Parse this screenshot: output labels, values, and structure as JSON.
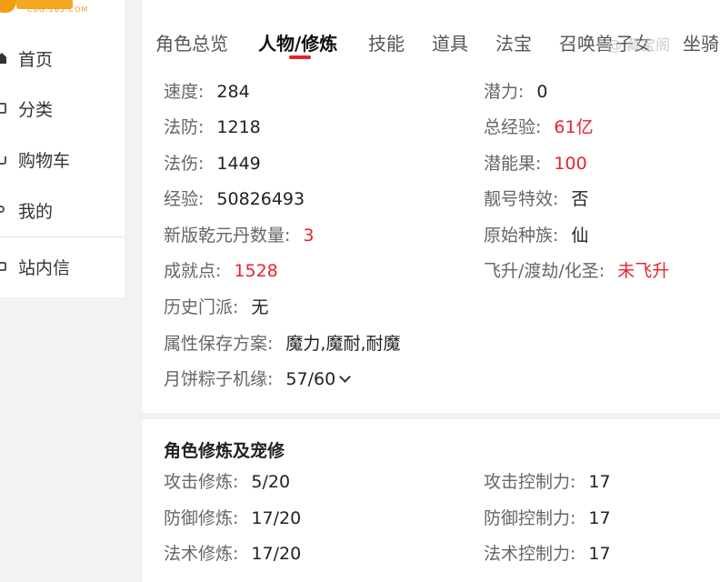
{
  "logo": {
    "sub": "CBG.163.COM"
  },
  "sidebar": {
    "items": [
      {
        "label": "首页",
        "icon": "home-icon"
      },
      {
        "label": "分类",
        "icon": "category-icon"
      },
      {
        "label": "购物车",
        "icon": "cart-icon"
      },
      {
        "label": "我的",
        "icon": "user-icon"
      },
      {
        "label": "站内信",
        "icon": "message-icon"
      }
    ]
  },
  "tabs": [
    "角色总览",
    "人物/修炼",
    "技能",
    "道具",
    "法宝",
    "召唤兽",
    "子女",
    "坐骑"
  ],
  "active_tab": "人物/修炼",
  "watermark": "@ 藏宝阁",
  "colors": {
    "accent": "#e8232d",
    "highlight": "#e8232d"
  },
  "attributes_left": [
    {
      "key": "速度:",
      "value": "284"
    },
    {
      "key": "法防:",
      "value": "1218"
    },
    {
      "key": "法伤:",
      "value": "1449"
    },
    {
      "key": "经验:",
      "value": "50826493"
    },
    {
      "key": "新版乾元丹数量:",
      "value": "3"
    },
    {
      "key": "成就点:",
      "value": "1528"
    },
    {
      "key": "历史门派:",
      "value": "无"
    },
    {
      "key": "属性保存方案:",
      "value": "魔力,魔耐,耐魔"
    },
    {
      "key": "月饼粽子机缘:",
      "value": "57/60"
    }
  ],
  "attributes_right": [
    {
      "key": "潜力:",
      "value": "0"
    },
    {
      "key": "总经验:",
      "value": "61亿"
    },
    {
      "key": "潜能果:",
      "value": "100"
    },
    {
      "key": "靓号特效:",
      "value": "否"
    },
    {
      "key": "原始种族:",
      "value": "仙"
    },
    {
      "key": "飞升/渡劫/化圣:",
      "value": "未飞升"
    }
  ],
  "cultivation": {
    "title": "角色修炼及宠修",
    "left": [
      {
        "key": "攻击修炼:",
        "value": "5/20"
      },
      {
        "key": "防御修炼:",
        "value": "17/20"
      },
      {
        "key": "法术修炼:",
        "value": "17/20"
      }
    ],
    "right": [
      {
        "key": "攻击控制力:",
        "value": "17"
      },
      {
        "key": "防御控制力:",
        "value": "17"
      },
      {
        "key": "法术控制力:",
        "value": "17"
      }
    ]
  }
}
